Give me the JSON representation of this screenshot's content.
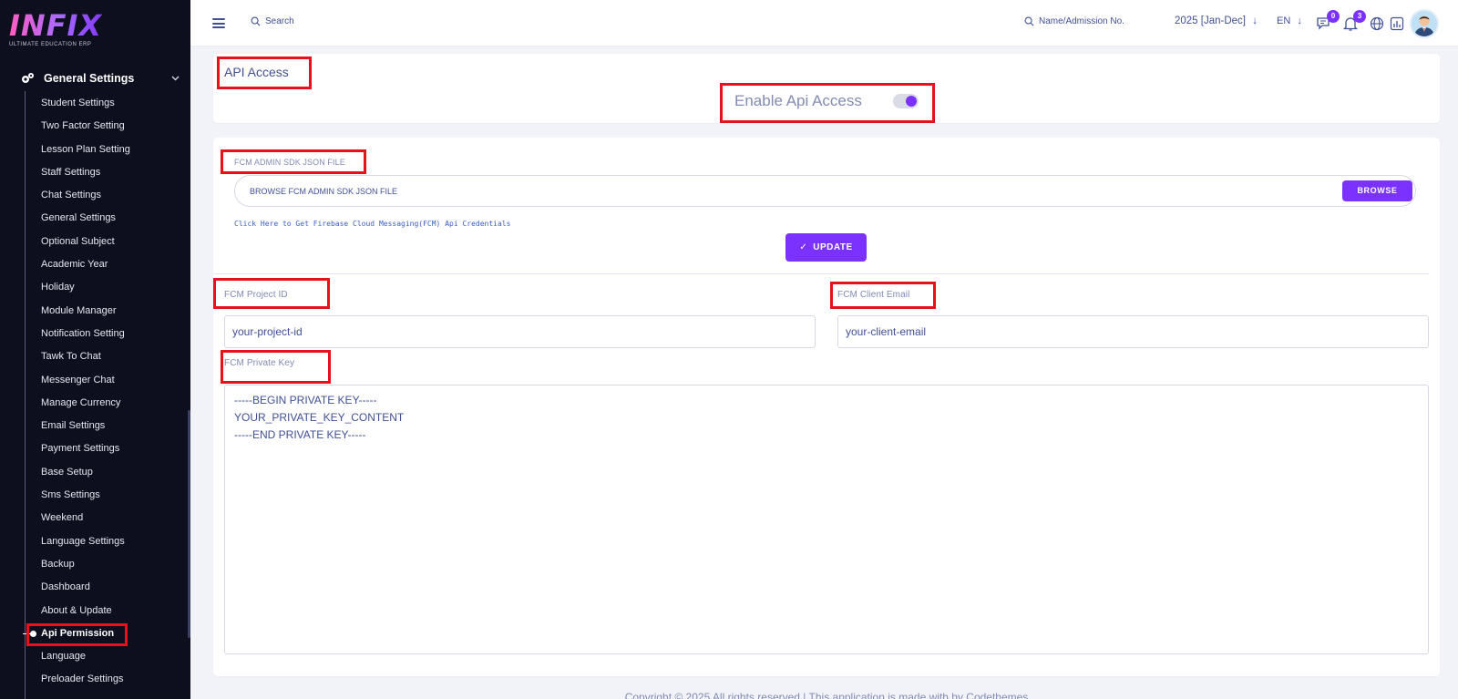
{
  "brand": {
    "logo_text": "INFIX",
    "logo_subtitle": "ULTIMATE EDUCATION ERP"
  },
  "sidebar": {
    "group_label": "General Settings",
    "items": [
      "Student Settings",
      "Two Factor Setting",
      "Lesson Plan Setting",
      "Staff Settings",
      "Chat Settings",
      "General Settings",
      "Optional Subject",
      "Academic Year",
      "Holiday",
      "Module Manager",
      "Notification Setting",
      "Tawk To Chat",
      "Messenger Chat",
      "Manage Currency",
      "Email Settings",
      "Payment Settings",
      "Base Setup",
      "Sms Settings",
      "Weekend",
      "Language Settings",
      "Backup",
      "Dashboard",
      "About & Update",
      "Api Permission",
      "Language",
      "Preloader Settings"
    ],
    "active_item": "Api Permission"
  },
  "topbar": {
    "search_label": "Search",
    "name_search_label": "Name/Admission No.",
    "academic_year": "2025 [Jan-Dec]",
    "language": "EN",
    "chat_count": "0",
    "notification_count": "3"
  },
  "api_access": {
    "title": "API Access",
    "enable_label": "Enable Api Access",
    "enabled": true
  },
  "fcm": {
    "json_file_label": "FCM ADMIN SDK JSON FILE",
    "json_file_placeholder": "BROWSE FCM ADMIN SDK JSON FILE",
    "browse_label": "BROWSE",
    "credentials_link": "Click Here to Get Firebase Cloud Messaging(FCM) Api Credentials",
    "update_label": "UPDATE",
    "project_id_label": "FCM Project ID",
    "project_id_value": "your-project-id",
    "client_email_label": "FCM Client Email",
    "client_email_value": "your-client-email",
    "private_key_label": "FCM Private Key",
    "private_key_value": "-----BEGIN PRIVATE KEY-----\nYOUR_PRIVATE_KEY_CONTENT\n-----END PRIVATE KEY-----"
  },
  "footer": {
    "text": "Copyright © 2025 All rights reserved | This application is made with by Codethemes"
  },
  "colors": {
    "accent": "#7c32ff",
    "sidebar_bg": "#0d0f1f",
    "highlight": "#e8101a",
    "text": "#415094"
  }
}
